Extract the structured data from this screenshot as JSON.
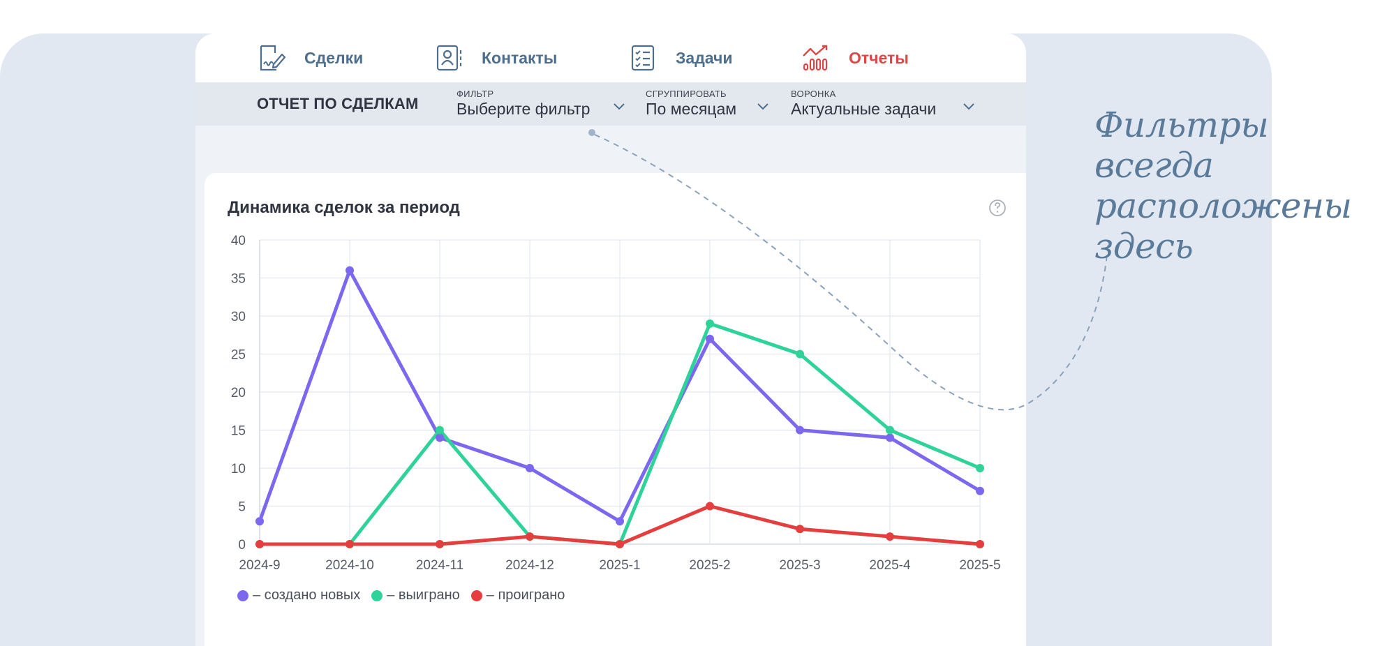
{
  "nav": {
    "tabs": [
      {
        "label": "Сделки",
        "icon": "deal-sign-icon",
        "active": false
      },
      {
        "label": "Контакты",
        "icon": "contact-card-icon",
        "active": false
      },
      {
        "label": "Задачи",
        "icon": "checklist-icon",
        "active": false
      },
      {
        "label": "Отчеты",
        "icon": "report-chart-icon",
        "active": true
      }
    ]
  },
  "toolbar": {
    "report_title": "ОТЧЕТ ПО СДЕЛКАМ",
    "filter": {
      "label": "ФИЛЬТР",
      "value": "Выберите фильтр"
    },
    "group": {
      "label": "СГРУППИРОВАТЬ",
      "value": "По месяцам"
    },
    "funnel": {
      "label": "ВОРОНКА",
      "value": "Актуальные задачи"
    }
  },
  "annotation": {
    "line1": "Фильтры всегда",
    "line2": "расположены здесь"
  },
  "colors": {
    "created": "#7b68ee",
    "won": "#2fd39a",
    "lost": "#e53e3e",
    "active_tab": "#e04444",
    "nav_text": "#4e6e8e",
    "background": "#e1e8f1"
  },
  "chart_data": {
    "type": "line",
    "title": "Динамика сделок за период",
    "xlabel": "",
    "ylabel": "",
    "categories": [
      "2024-9",
      "2024-10",
      "2024-11",
      "2024-12",
      "2025-1",
      "2025-2",
      "2025-3",
      "2025-4",
      "2025-5"
    ],
    "ylim": [
      0,
      40
    ],
    "yticks": [
      0,
      5,
      10,
      15,
      20,
      25,
      30,
      35,
      40
    ],
    "grid": true,
    "legend_position": "bottom-left",
    "series": [
      {
        "name": "– создано новых",
        "color": "#7b68ee",
        "values": [
          3,
          36,
          14,
          10,
          3,
          27,
          15,
          14,
          7
        ]
      },
      {
        "name": "– выиграно",
        "color": "#2fd39a",
        "values": [
          0,
          0,
          15,
          1,
          0,
          29,
          25,
          15,
          10
        ]
      },
      {
        "name": "– проиграно",
        "color": "#e53e3e",
        "values": [
          0,
          0,
          0,
          1,
          0,
          5,
          2,
          1,
          0
        ]
      }
    ]
  }
}
